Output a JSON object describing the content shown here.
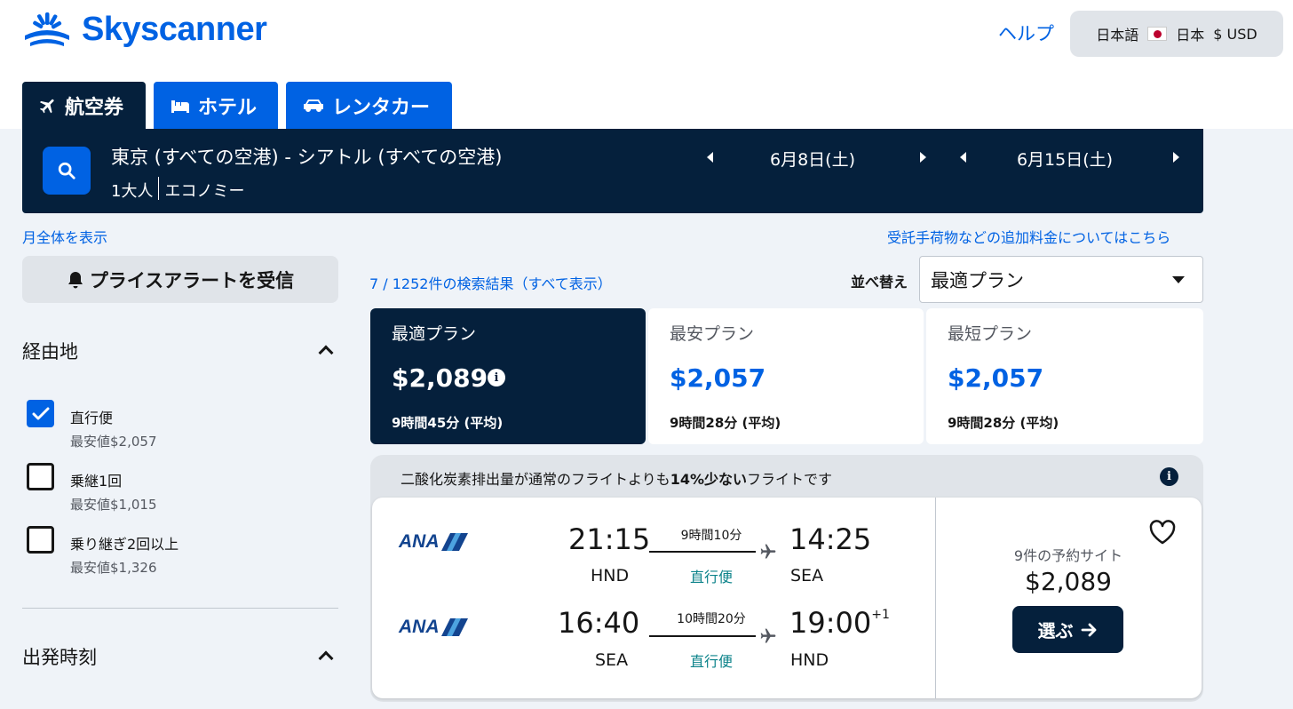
{
  "header": {
    "logo_text": "Skyscanner",
    "help_label": "ヘルプ",
    "locale": {
      "language": "日本語",
      "country": "日本",
      "currency": "$ USD"
    }
  },
  "tabs": [
    {
      "label": "航空券",
      "active": true
    },
    {
      "label": "ホテル",
      "active": false
    },
    {
      "label": "レンタカー",
      "active": false
    }
  ],
  "search": {
    "route": "東京 (すべての空港) - シアトル (すべての空港)",
    "travellers": "1大人",
    "cabin": "エコノミー",
    "depart_date": "6月8日(土)",
    "return_date": "6月15日(土)"
  },
  "links": {
    "whole_month": "月全体を表示",
    "extra_fees": "受託手荷物などの追加料金についてはこちら"
  },
  "sidebar": {
    "price_alert_label": "プライスアラートを受信",
    "stops": {
      "title": "経由地",
      "options": [
        {
          "label": "直行便",
          "sub": "最安値$2,057",
          "checked": true
        },
        {
          "label": "乗継1回",
          "sub": "最安値$1,015",
          "checked": false
        },
        {
          "label": "乗り継ぎ2回以上",
          "sub": "最安値$1,326",
          "checked": false
        }
      ]
    },
    "departure_time_title": "出発時刻"
  },
  "results": {
    "count_text": "7 / 1252件の検索結果（すべて表示）",
    "sort_label": "並べ替え",
    "sort_value": "最適プラン",
    "summary": [
      {
        "title": "最適プラン",
        "price": "$2,089",
        "duration": "9時間45分 (平均)",
        "active": true
      },
      {
        "title": "最安プラン",
        "price": "$2,057",
        "duration": "9時間28分 (平均)",
        "active": false
      },
      {
        "title": "最短プラン",
        "price": "$2,057",
        "duration": "9時間28分 (平均)",
        "active": false
      }
    ],
    "eco_banner": {
      "prefix": "二酸化炭素排出量が通常のフライトよりも",
      "highlight": "14%少ない",
      "suffix": "フライトです"
    },
    "itinerary": {
      "legs": [
        {
          "airline": "ANA",
          "depart_time": "21:15",
          "depart_code": "HND",
          "duration": "9時間10分",
          "stops": "直行便",
          "arrive_time": "14:25",
          "arrive_code": "SEA",
          "day_offset": ""
        },
        {
          "airline": "ANA",
          "depart_time": "16:40",
          "depart_code": "SEA",
          "duration": "10時間20分",
          "stops": "直行便",
          "arrive_time": "19:00",
          "arrive_code": "HND",
          "day_offset": "+1"
        }
      ],
      "sites_text": "9件の予約サイト",
      "price": "$2,089",
      "select_label": "選ぶ"
    }
  },
  "colors": {
    "brand_blue": "#0062e3",
    "navy": "#05203c",
    "page_bg": "#eff3f8",
    "direct_green": "#0c838a"
  }
}
